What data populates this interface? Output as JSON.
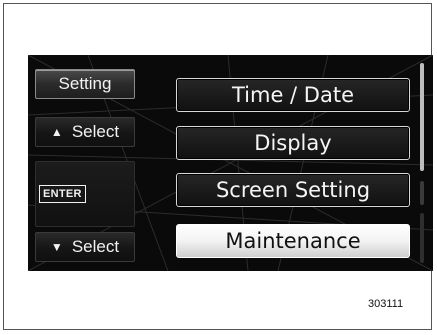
{
  "left_panel": {
    "setting_label": "Setting",
    "up_label": "Select",
    "up_arrow": "▲",
    "enter_label": "ENTER",
    "down_label": "Select",
    "down_arrow": "▼"
  },
  "menu": {
    "items": [
      {
        "label": "Time / Date"
      },
      {
        "label": "Display"
      },
      {
        "label": "Screen Setting"
      },
      {
        "label": "Maintenance"
      }
    ],
    "selected": "Maintenance"
  },
  "scroll": {
    "position_fraction": 0.8
  },
  "figure_number": "303111",
  "colors": {
    "screen_background": "#0a0a0a",
    "highlight": "#ffffff",
    "text": "#f5f5f5"
  }
}
